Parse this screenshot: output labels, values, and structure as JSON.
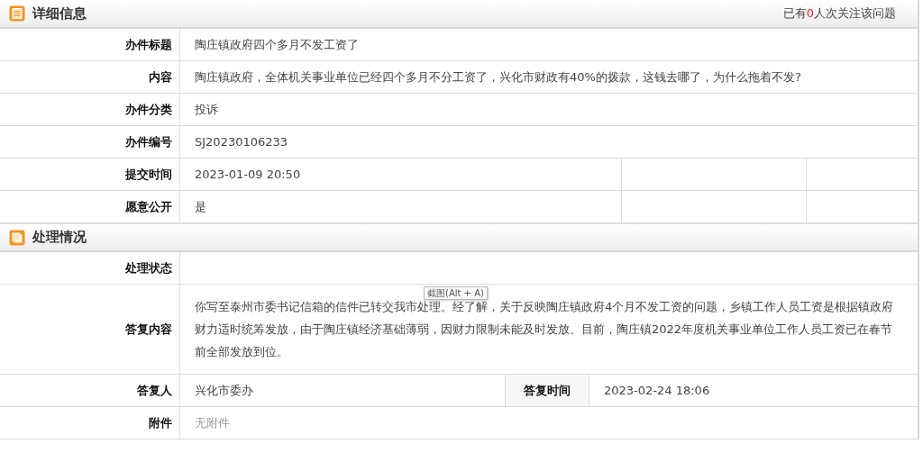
{
  "sections": [
    {
      "title": "详细信息",
      "watch": {
        "prefix": "已有",
        "count": "0",
        "suffix": "人次关注该问题"
      },
      "rows": [
        {
          "kind": "plain",
          "label": "办件标题",
          "value": "陶庄镇政府四个多月不发工资了"
        },
        {
          "kind": "plain",
          "label": "内容",
          "value": "陶庄镇政府，全体机关事业单位已经四个多月不分工资了，兴化市财政有40%的拨款，这钱去哪了，为什么拖着不发?"
        },
        {
          "kind": "plain",
          "label": "办件分类",
          "value": "投诉"
        },
        {
          "kind": "plain",
          "label": "办件编号",
          "value": "SJ20230106233"
        },
        {
          "kind": "blanks",
          "label": "提交时间",
          "value": "2023-01-09 20:50"
        },
        {
          "kind": "blanks",
          "label": "愿意公开",
          "value": "是"
        }
      ]
    },
    {
      "title": "处理情况",
      "rows": [
        {
          "kind": "plain",
          "label": "处理状态"
        },
        {
          "kind": "paragraph",
          "label": "答复内容",
          "value": "你写至泰州市委书记信箱的信件已转交我市处理。经了解，关于反映陶庄镇政府4个月不发工资的问题，乡镇工作人员工资是根据镇政府财力适时统筹发放，由于陶庄镇经济基础薄弱，因财力限制未能及时发放。目前，陶庄镇2022年度机关事业单位工作人员工资已在春节前全部发放到位。",
          "tooltip": "截图(Alt + A)"
        },
        {
          "kind": "pair",
          "label": "答复人",
          "value": "兴化市委办",
          "label2": "答复时间",
          "value2": "2023-02-24 18:06"
        },
        {
          "kind": "muted",
          "label": "附件",
          "value": "无附件"
        }
      ]
    }
  ]
}
